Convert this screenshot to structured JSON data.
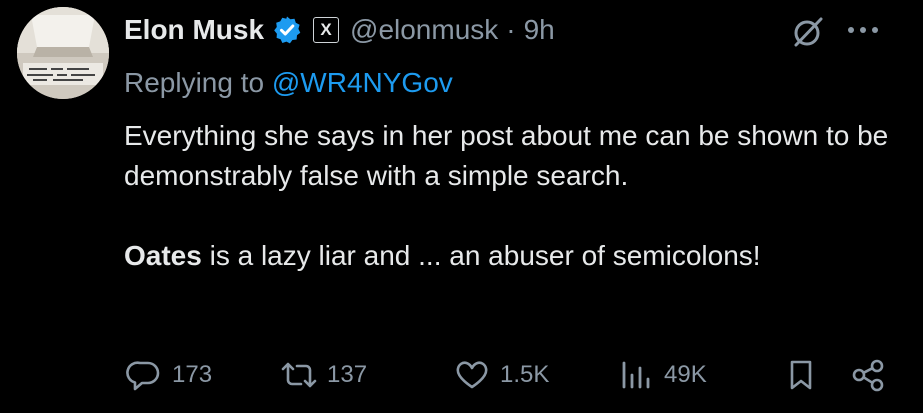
{
  "tweet": {
    "author_name": "Elon Musk",
    "x_badge": "X",
    "handle": "@elonmusk",
    "separator": "·",
    "time": "9h",
    "replying_prefix": "Replying to ",
    "replying_to": "@WR4NYGov",
    "paragraph_1": "Everything she says in her post about me can be shown to be demonstrably false with a simple search.",
    "paragraph_2_bold": "Oates",
    "paragraph_2_rest": " is a lazy liar and ... an abuser of semicolons!"
  },
  "actions": {
    "replies": "173",
    "reposts": "137",
    "likes": "1.5K",
    "views": "49K"
  },
  "icons": {
    "verified": "verified-badge-icon",
    "grok": "grok-icon",
    "more": "more-dots-icon",
    "reply": "reply-icon",
    "repost": "repost-icon",
    "like": "heart-icon",
    "views": "views-chart-icon",
    "bookmark": "bookmark-icon",
    "share": "share-icon"
  },
  "colors": {
    "background": "#000000",
    "text": "#e7e9ea",
    "muted": "#8b98a5",
    "accent": "#1d9bf0"
  }
}
